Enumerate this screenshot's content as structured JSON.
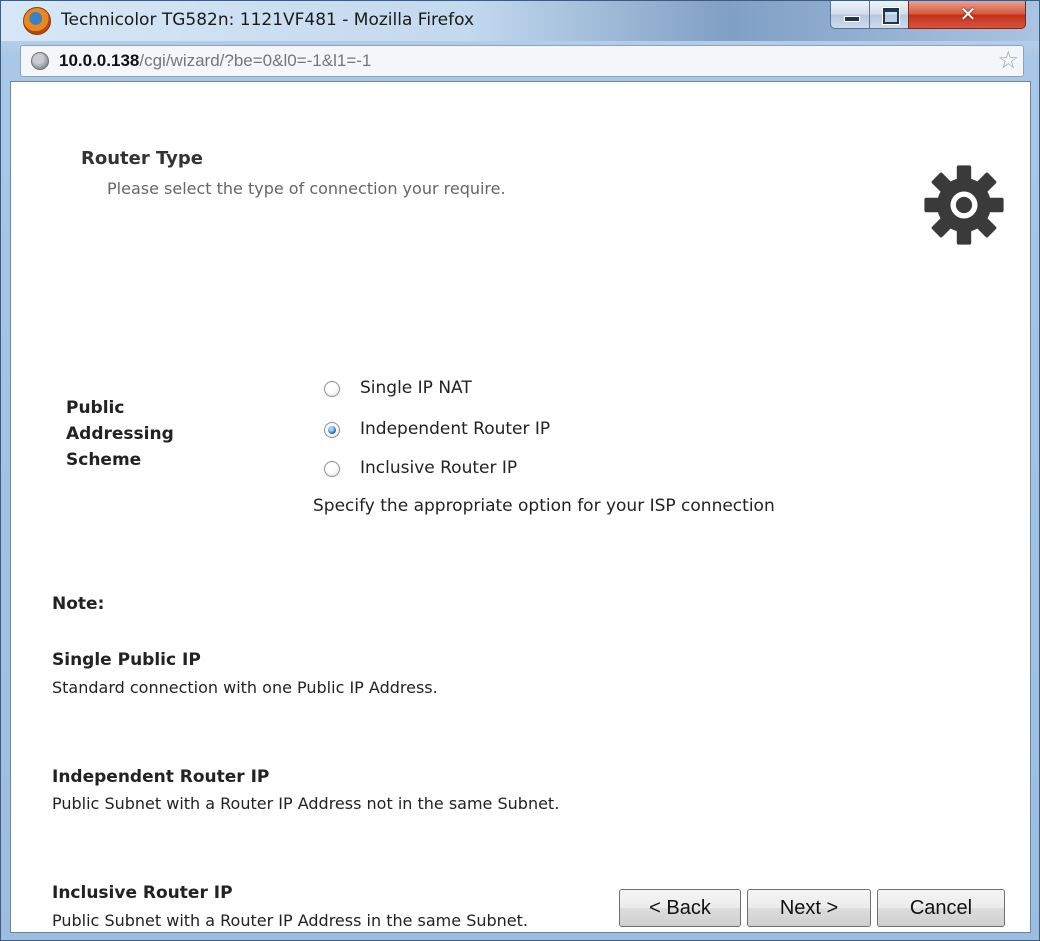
{
  "window": {
    "title": "Technicolor TG582n:  1121VF481 - Mozilla Firefox",
    "close_glyph": "✕",
    "star_glyph": "☆"
  },
  "urlbar": {
    "host": "10.0.0.138",
    "path": "/cgi/wizard/?be=0&l0=-1&l1=-1"
  },
  "header": {
    "title": "Router Type",
    "subtitle": "Please select the type of connection your require.",
    "icon": "gear-icon"
  },
  "form": {
    "label_lines": [
      "Public",
      "Addressing",
      "Scheme"
    ],
    "options": [
      {
        "label": "Single IP NAT",
        "selected": false
      },
      {
        "label": "Independent Router IP",
        "selected": true
      },
      {
        "label": "Inclusive Router IP",
        "selected": false
      }
    ],
    "hint": "Specify the appropriate option for your ISP connection"
  },
  "notes": {
    "heading": "Note:",
    "items": [
      {
        "title": "Single Public IP",
        "desc": "Standard connection with one Public IP Address."
      },
      {
        "title": "Independent Router IP",
        "desc": "Public Subnet with a Router IP Address not in the same Subnet."
      },
      {
        "title": "Inclusive Router IP",
        "desc": "Public Subnet with a Router IP Address in the same Subnet."
      }
    ]
  },
  "buttons": {
    "back": "< Back",
    "next": "Next >",
    "cancel": "Cancel"
  },
  "colors": {
    "titlebar": "#c3d9ef",
    "close_button": "#c23118",
    "radio_selected": "#1e5fa8"
  }
}
